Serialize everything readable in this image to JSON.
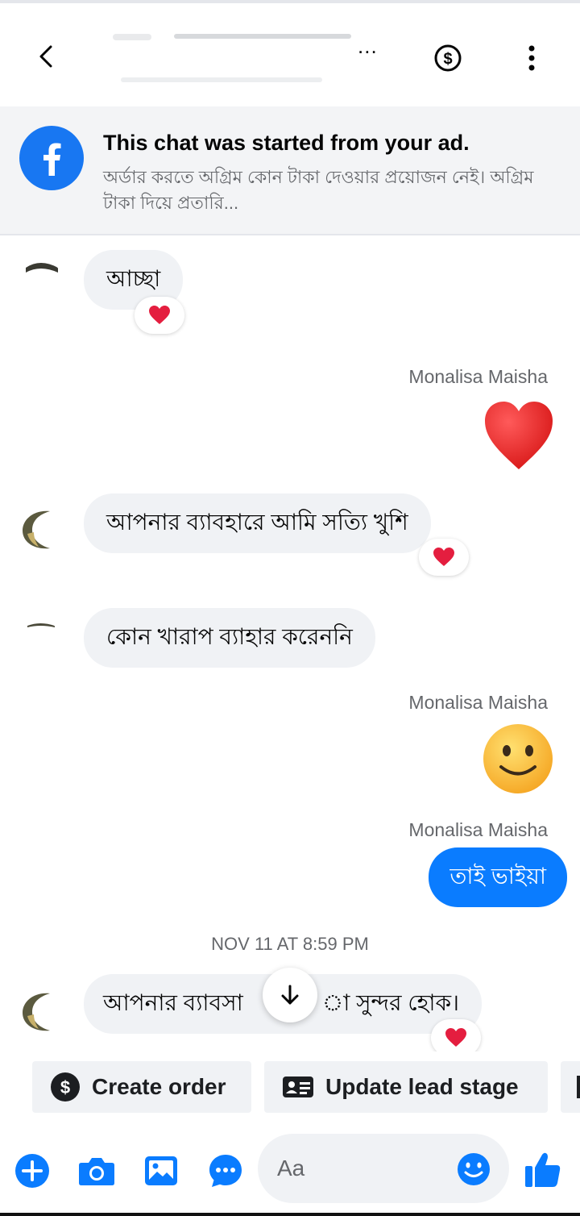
{
  "header": {
    "title_suffix": "..."
  },
  "ad_banner": {
    "title": "This chat was started from your ad.",
    "text": "অর্ডার করতে অগ্রিম কোন টাকা দেওয়ার প্রয়োজন নেই। অগ্রিম টাকা দিয়ে প্রতারি..."
  },
  "messages": [
    {
      "direction": "in",
      "text": "আচ্ছা",
      "reaction": "heart"
    },
    {
      "direction": "out",
      "sender": "Monalisa Maisha",
      "emoji": "heart"
    },
    {
      "direction": "in",
      "text": "আপনার ব্যাবহারে আমি সত্যি খুশি",
      "reaction": "heart"
    },
    {
      "direction": "in",
      "text": "কোন খারাপ ব্যাহার করেননি"
    },
    {
      "direction": "out",
      "sender": "Monalisa Maisha",
      "emoji": "smiley"
    },
    {
      "direction": "out",
      "sender": "Monalisa Maisha",
      "text": "তাই ভাইয়া"
    },
    {
      "direction": "timestamp",
      "text": "NOV 11 AT 8:59 PM"
    },
    {
      "direction": "in",
      "text_left": "আপনার ব্যাবসা",
      "text_right": "া সুন্দর হোক।",
      "reaction": "heart"
    }
  ],
  "quick_actions": [
    {
      "label": "Create order",
      "icon": "dollar-circle-icon"
    },
    {
      "label": "Update lead stage",
      "icon": "id-card-icon"
    }
  ],
  "composer": {
    "placeholder": "Aa",
    "icons": [
      "plus-icon",
      "camera-icon",
      "image-icon",
      "chat-bubble-icon",
      "emoji-icon",
      "thumbs-up-icon"
    ]
  },
  "colors": {
    "accent": "#0a7cff",
    "facebook_blue": "#1877f2",
    "incoming_bubble": "#f0f2f5",
    "heart": "#e41e3f"
  }
}
